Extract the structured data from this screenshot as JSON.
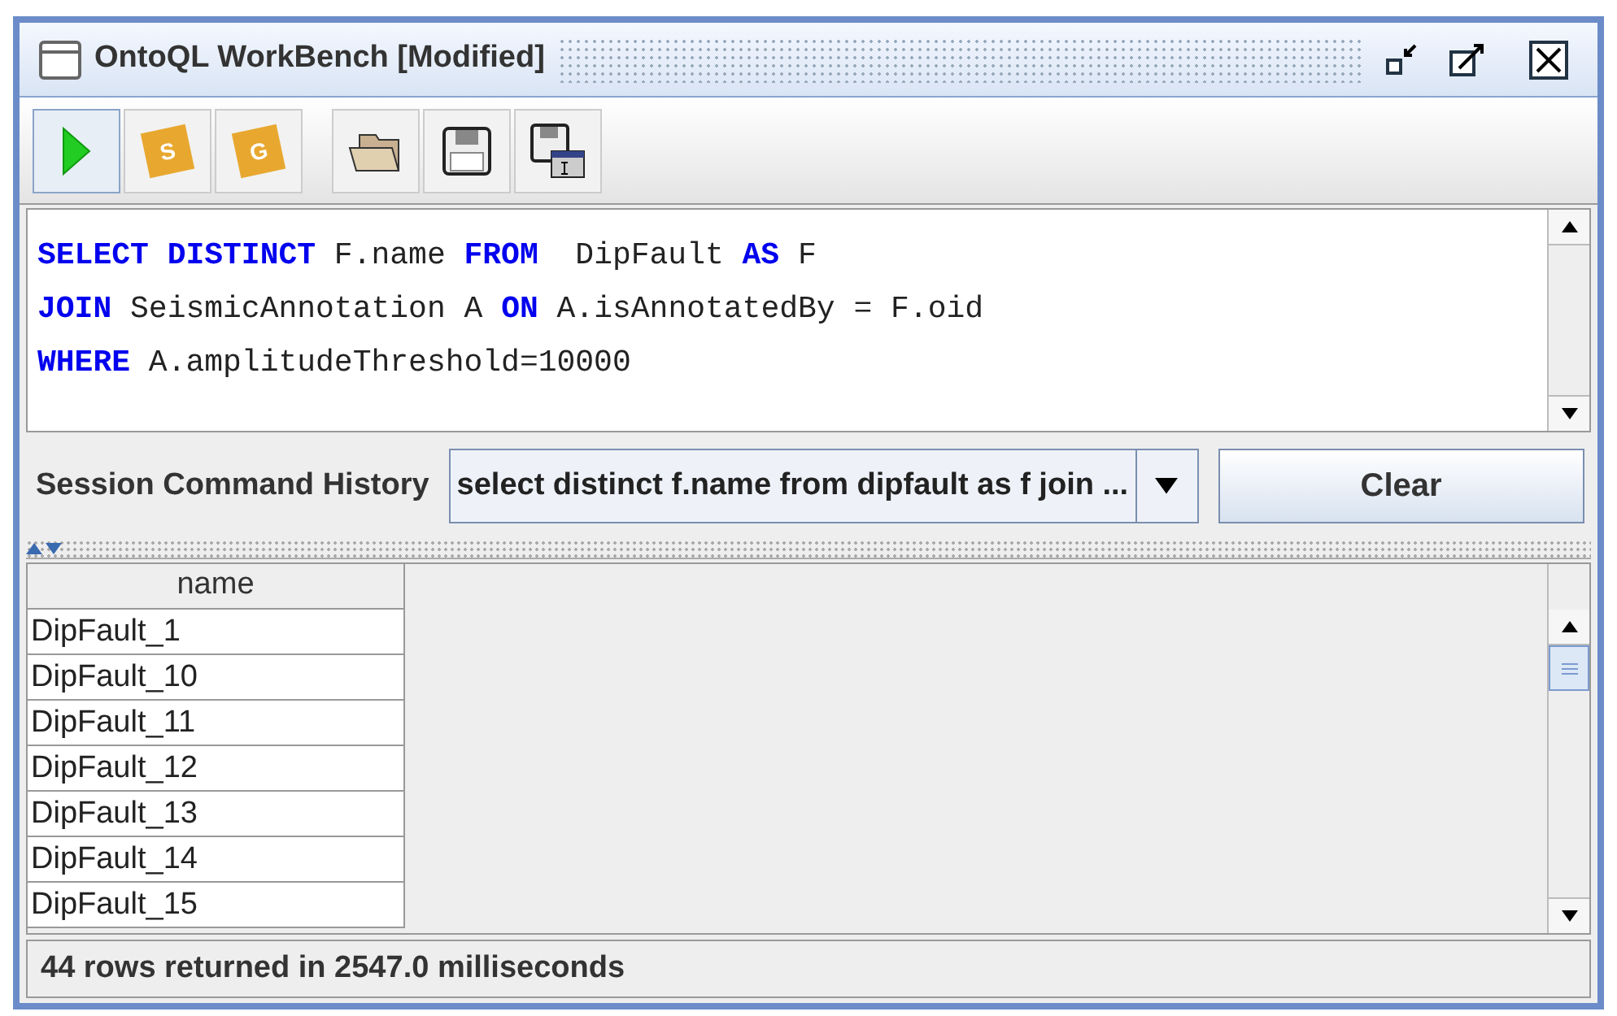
{
  "window": {
    "title": "OntoQL WorkBench [Modified]"
  },
  "toolbar": [
    {
      "kind": "run",
      "selected": true
    },
    {
      "kind": "s"
    },
    {
      "kind": "g"
    },
    {
      "kind": "open"
    },
    {
      "kind": "save"
    },
    {
      "kind": "saveas"
    }
  ],
  "toolbar_letters": {
    "s": "S",
    "g": "G"
  },
  "editor": {
    "lines": [
      [
        {
          "kind": "keyword",
          "text": "SELECT DISTINCT"
        },
        {
          "kind": "text",
          "text": " F.name "
        },
        {
          "kind": "keyword",
          "text": "FROM"
        },
        {
          "kind": "text",
          "text": "  DipFault "
        },
        {
          "kind": "keyword",
          "text": "AS"
        },
        {
          "kind": "text",
          "text": " F"
        }
      ],
      [
        {
          "kind": "keyword",
          "text": "JOIN"
        },
        {
          "kind": "text",
          "text": " SeismicAnnotation A "
        },
        {
          "kind": "keyword",
          "text": "ON"
        },
        {
          "kind": "text",
          "text": " A.isAnnotatedBy = F.oid"
        }
      ],
      [
        {
          "kind": "keyword",
          "text": "WHERE"
        },
        {
          "kind": "text",
          "text": " A.amplitudeThreshold=10000"
        }
      ]
    ]
  },
  "history": {
    "label": "Session Command History",
    "value": "select distinct f.name from dipfault as f join ...",
    "button": "Clear"
  },
  "table": {
    "columns": [
      "name"
    ],
    "rows": [
      "DipFault_1",
      "DipFault_10",
      "DipFault_11",
      "DipFault_12",
      "DipFault_13",
      "DipFault_14",
      "DipFault_15"
    ]
  },
  "status_bar": "44 rows returned in 2547.0 milliseconds"
}
